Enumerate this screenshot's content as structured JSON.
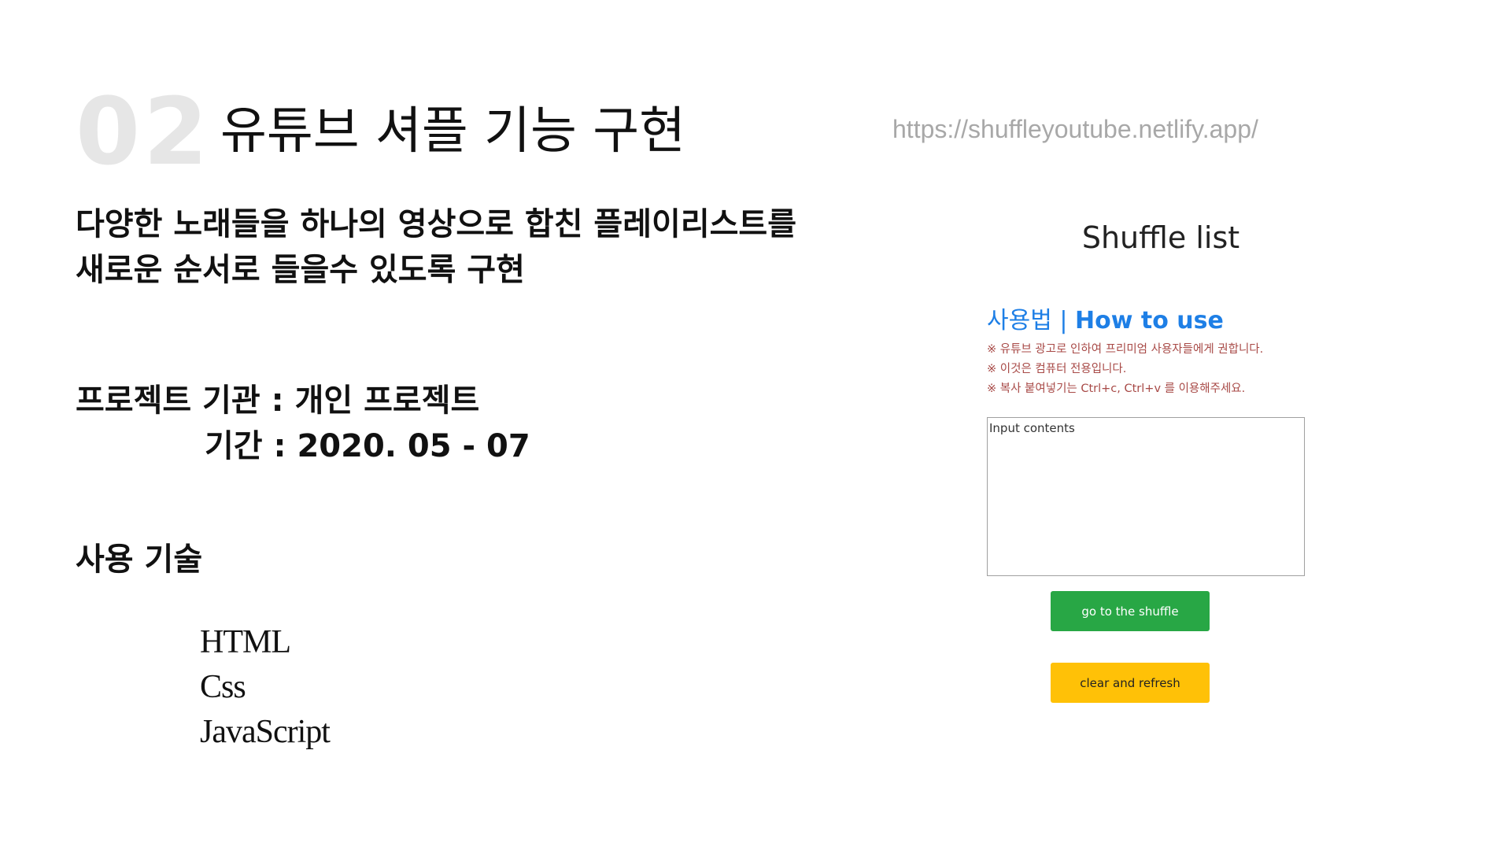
{
  "slide": {
    "number": "02",
    "title": "유튜브 셔플 기능 구현",
    "url": "https://shuffleyoutube.netlify.app/"
  },
  "description": {
    "line1": "다양한 노래들을 하나의 영상으로 합친 플레이리스트를",
    "line2": "새로운 순서로 들을수 있도록 구현"
  },
  "project": {
    "org": "프로젝트 기관 : 개인 프로젝트",
    "period": "기간 : 2020. 05 - 07"
  },
  "tech": {
    "heading": "사용 기술",
    "items": [
      "HTML",
      "Css",
      "JavaScript"
    ]
  },
  "app": {
    "title": "Shuffle list",
    "howto_ko": "사용법",
    "howto_sep": " | ",
    "howto_en": "How to use",
    "notes": [
      "※ 유튜브 광고로 인하여 프리미엄 사용자들에게 권합니다.",
      "※ 이것은 컴퓨터 전용입니다.",
      "※ 복사 붙여넣기는 Ctrl+c, Ctrl+v 를 이용해주세요."
    ],
    "input_placeholder": "Input contents",
    "shuffle_button": "go to the shuffle",
    "clear_button": "clear and refresh",
    "colors": {
      "howto": "#1e7fe6",
      "notes": "#a84a47",
      "shuffle_button": "#28a745",
      "clear_button": "#ffc107"
    }
  }
}
